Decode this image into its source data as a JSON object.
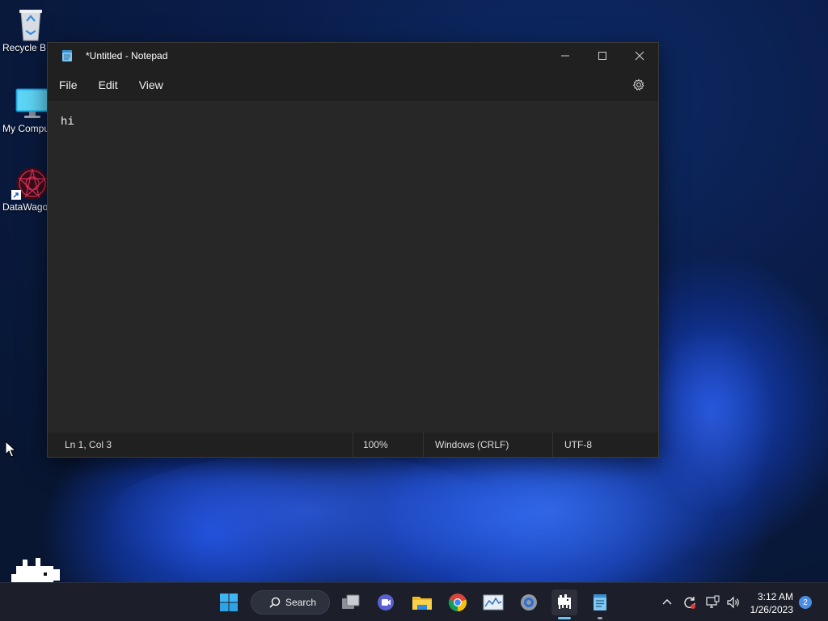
{
  "desktop": {
    "icons": [
      {
        "label": "Recycle B"
      },
      {
        "label": "My Compu"
      },
      {
        "label": "DataWago"
      }
    ]
  },
  "notepad": {
    "title": "*Untitled - Notepad",
    "menu": [
      "File",
      "Edit",
      "View"
    ],
    "content": "hi",
    "status": {
      "position": "Ln 1, Col 3",
      "zoom": "100%",
      "line_ending": "Windows (CRLF)",
      "encoding": "UTF-8"
    }
  },
  "taskbar": {
    "search_label": "Search",
    "pinned": [
      "start-icon",
      "search",
      "task-view-icon",
      "teams-chat-icon",
      "file-explorer-icon",
      "chrome-icon",
      "performance-monitor-icon",
      "settings-icon",
      "datawagon-icon",
      "notepad-icon"
    ],
    "clock": {
      "time": "3:12 AM",
      "date": "1/26/2023"
    },
    "notification_count": "2"
  },
  "colors": {
    "accent": "#4a8ee6",
    "window_bg": "#202020",
    "editor_bg": "#272727",
    "taskbar_bg": "#1c1f2a"
  }
}
